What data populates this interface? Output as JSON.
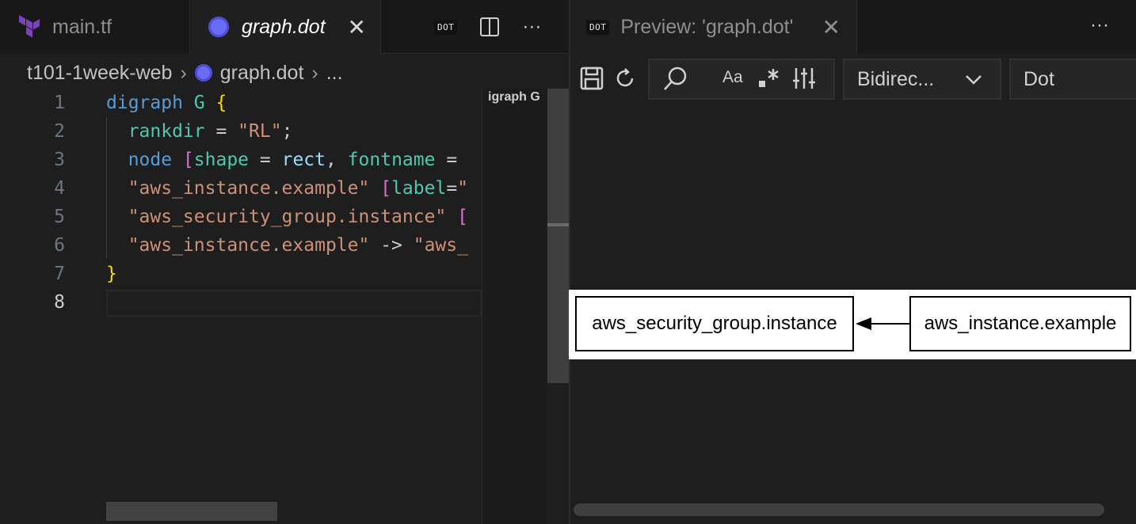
{
  "left_group": {
    "tabs": [
      {
        "label": "main.tf",
        "icon": "terraform-icon",
        "active": false
      },
      {
        "label": "graph.dot",
        "icon": "graphviz-icon",
        "active": true
      }
    ],
    "badge": "DOT",
    "breadcrumb": [
      "t101-1week-web",
      "graph.dot",
      "..."
    ],
    "minimap_text": "igraph G",
    "code_lines": [
      {
        "n": "1",
        "tokens": [
          {
            "t": "digraph ",
            "c": "kw"
          },
          {
            "t": "G",
            "c": "ty"
          },
          {
            "t": " ",
            "c": "pun"
          },
          {
            "t": "{",
            "c": "br1"
          }
        ]
      },
      {
        "n": "2",
        "tokens": [
          {
            "t": "  rankdir",
            "c": "attr"
          },
          {
            "t": " = ",
            "c": "pun"
          },
          {
            "t": "\"RL\"",
            "c": "str"
          },
          {
            "t": ";",
            "c": "pun"
          }
        ]
      },
      {
        "n": "3",
        "tokens": [
          {
            "t": "  node ",
            "c": "kw"
          },
          {
            "t": "[",
            "c": "br2"
          },
          {
            "t": "shape",
            "c": "attr"
          },
          {
            "t": " = ",
            "c": "pun"
          },
          {
            "t": "rect",
            "c": "var"
          },
          {
            "t": ", ",
            "c": "pun"
          },
          {
            "t": "fontname",
            "c": "attr"
          },
          {
            "t": " = ",
            "c": "pun"
          }
        ]
      },
      {
        "n": "4",
        "tokens": [
          {
            "t": "  \"aws_instance.example\"",
            "c": "str"
          },
          {
            "t": " ",
            "c": "pun"
          },
          {
            "t": "[",
            "c": "br2"
          },
          {
            "t": "label",
            "c": "attr"
          },
          {
            "t": "=",
            "c": "pun"
          },
          {
            "t": "\"",
            "c": "str"
          }
        ]
      },
      {
        "n": "5",
        "tokens": [
          {
            "t": "  \"aws_security_group.instance\"",
            "c": "str"
          },
          {
            "t": " ",
            "c": "pun"
          },
          {
            "t": "[",
            "c": "br2"
          }
        ]
      },
      {
        "n": "6",
        "tokens": [
          {
            "t": "  \"aws_instance.example\"",
            "c": "str"
          },
          {
            "t": " -> ",
            "c": "pun"
          },
          {
            "t": "\"aws_",
            "c": "str"
          }
        ]
      },
      {
        "n": "7",
        "tokens": [
          {
            "t": "}",
            "c": "br1"
          }
        ]
      },
      {
        "n": "8",
        "tokens": []
      }
    ]
  },
  "right_group": {
    "tab": {
      "label": "Preview: 'graph.dot'",
      "badge": "DOT"
    },
    "direction_select": "Bidirec...",
    "engine_select": "Dot",
    "graph": {
      "nodes": [
        "aws_security_group.instance",
        "aws_instance.example"
      ],
      "edge": {
        "from": "aws_instance.example",
        "to": "aws_security_group.instance"
      }
    }
  },
  "colors": {
    "background": "#1e1e1e",
    "tab_bar": "#181818",
    "graph_accent": "#6b6cf5",
    "terraform": "#7b42bc"
  }
}
